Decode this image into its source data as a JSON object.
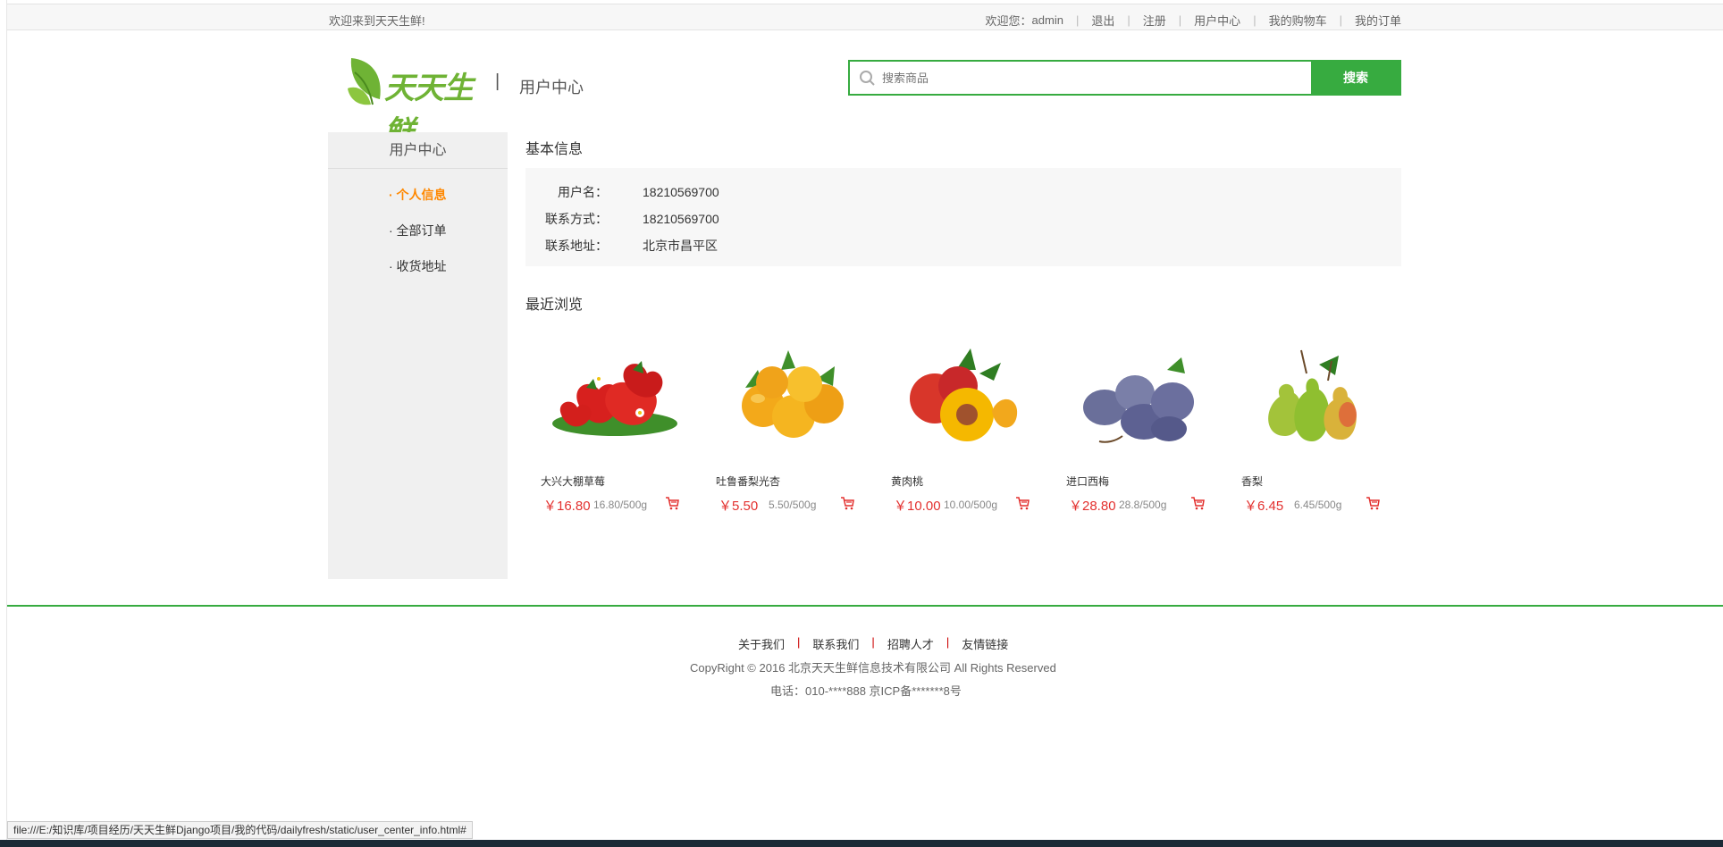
{
  "topbar": {
    "welcome": "欢迎来到天天生鲜!",
    "user_prefix": "欢迎您：",
    "username": "admin",
    "links": [
      "退出",
      "注册",
      "用户中心",
      "我的购物车",
      "我的订单"
    ]
  },
  "header": {
    "logo_text": "天天生鲜",
    "divider": "|",
    "subtitle": "用户中心"
  },
  "search": {
    "placeholder": "搜索商品",
    "button": "搜索"
  },
  "sidebar": {
    "title": "用户中心",
    "items": [
      {
        "label": "· 个人信息",
        "active": true
      },
      {
        "label": "· 全部订单",
        "active": false
      },
      {
        "label": "· 收货地址",
        "active": false
      }
    ]
  },
  "basic_info": {
    "title": "基本信息",
    "rows": [
      {
        "label": "用户名：",
        "value": "18210569700"
      },
      {
        "label": "联系方式：",
        "value": "18210569700"
      },
      {
        "label": "联系地址：",
        "value": "北京市昌平区"
      }
    ]
  },
  "recent": {
    "title": "最近浏览",
    "goods": [
      {
        "name": "大兴大棚草莓",
        "price": "￥16.80",
        "unit": "16.80/500g",
        "pic": "strawberry"
      },
      {
        "name": "吐鲁番梨光杏",
        "price": "￥5.50",
        "unit": "5.50/500g",
        "pic": "apricot"
      },
      {
        "name": "黄肉桃",
        "price": "￥10.00",
        "unit": "10.00/500g",
        "pic": "peach"
      },
      {
        "name": "进口西梅",
        "price": "￥28.80",
        "unit": "28.8/500g",
        "pic": "plum"
      },
      {
        "name": "香梨",
        "price": "￥6.45",
        "unit": "6.45/500g",
        "pic": "pear"
      }
    ]
  },
  "footer": {
    "links": [
      "关于我们",
      "联系我们",
      "招聘人才",
      "友情链接"
    ],
    "copyright": "CopyRight © 2016 北京天天生鲜信息技术有限公司 All Rights Reserved",
    "tel": "电话：010-****888 京ICP备*******8号"
  },
  "statusbar": {
    "url": "file:///E:/知识库/项目经历/天天生鲜Django项目/我的代码/dailyfresh/static/user_center_info.html#"
  },
  "colors": {
    "brand_green": "#37ab40",
    "active_orange": "#ff8800",
    "price_red": "#e3302e"
  }
}
